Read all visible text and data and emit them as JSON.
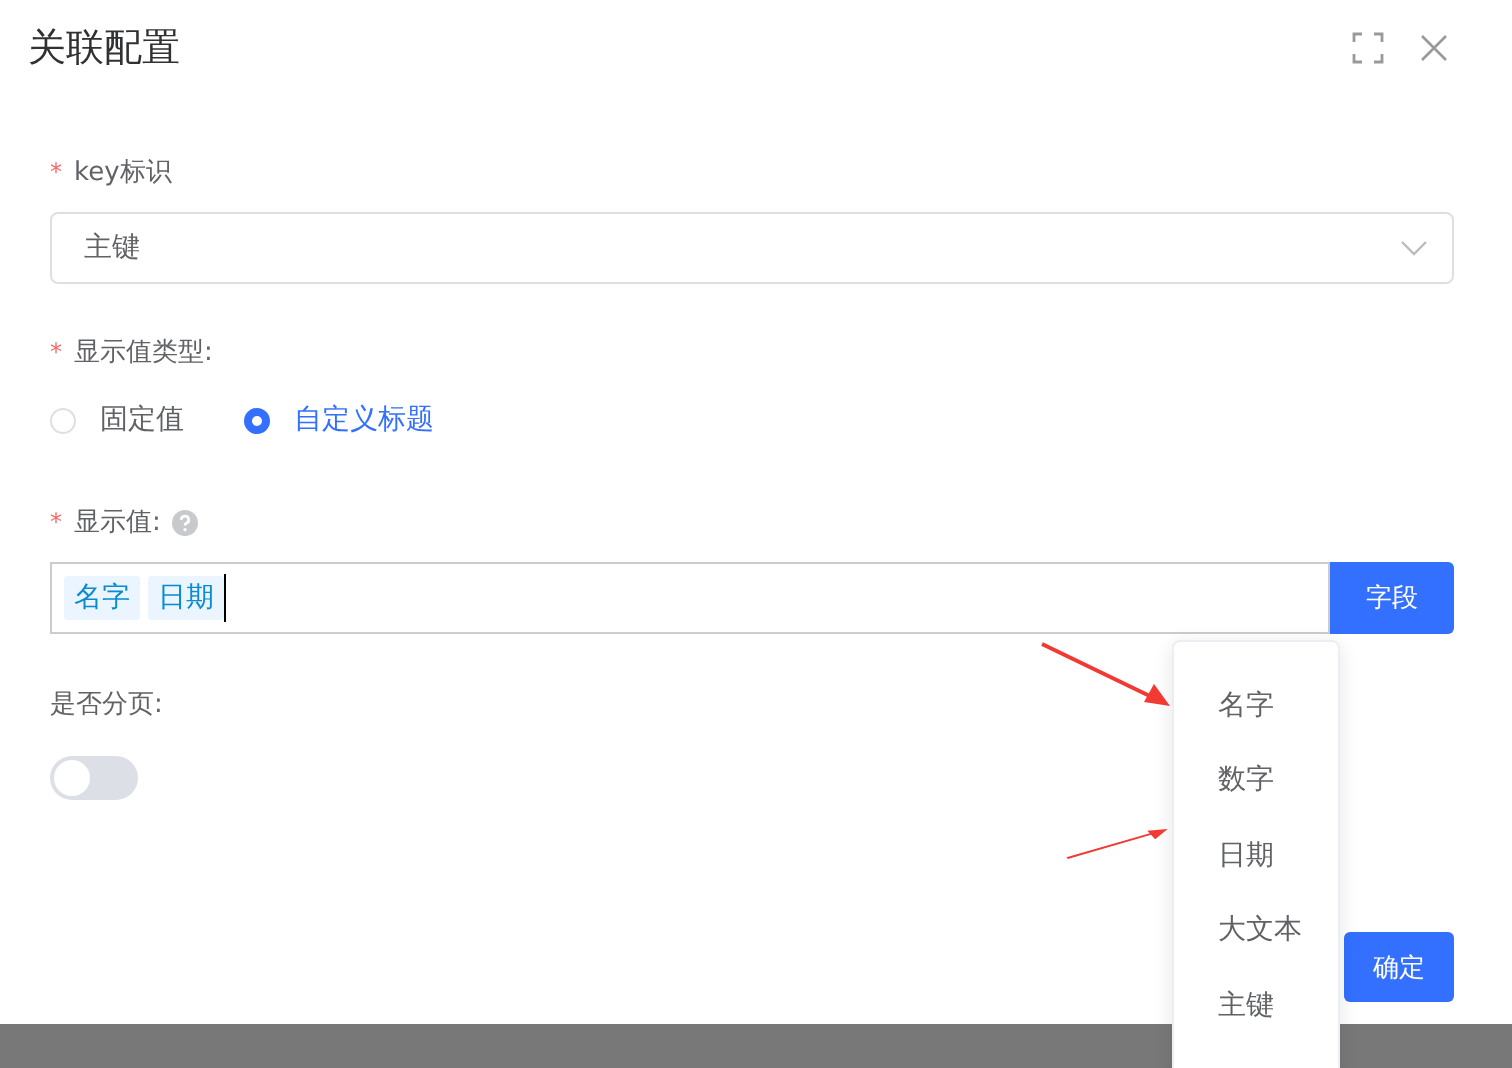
{
  "dialog": {
    "title": "关联配置"
  },
  "key_field": {
    "label": "key标识",
    "required_mark": "*",
    "value": "主键"
  },
  "display_type": {
    "label": "显示值类型:",
    "required_mark": "*",
    "options": [
      {
        "label": "固定值",
        "selected": false
      },
      {
        "label": "自定义标题",
        "selected": true
      }
    ]
  },
  "display_value": {
    "label": "显示值:",
    "required_mark": "*",
    "tags": [
      "名字",
      "日期"
    ],
    "button": "字段"
  },
  "paging": {
    "label": "是否分页:",
    "on": false
  },
  "field_menu": {
    "items": [
      {
        "label": "名字",
        "marked": true
      },
      {
        "label": "数字",
        "marked": false
      },
      {
        "label": "日期",
        "marked": true
      },
      {
        "label": "大文本",
        "marked": false
      },
      {
        "label": "主键",
        "marked": false
      }
    ]
  },
  "confirm_button": "确定"
}
